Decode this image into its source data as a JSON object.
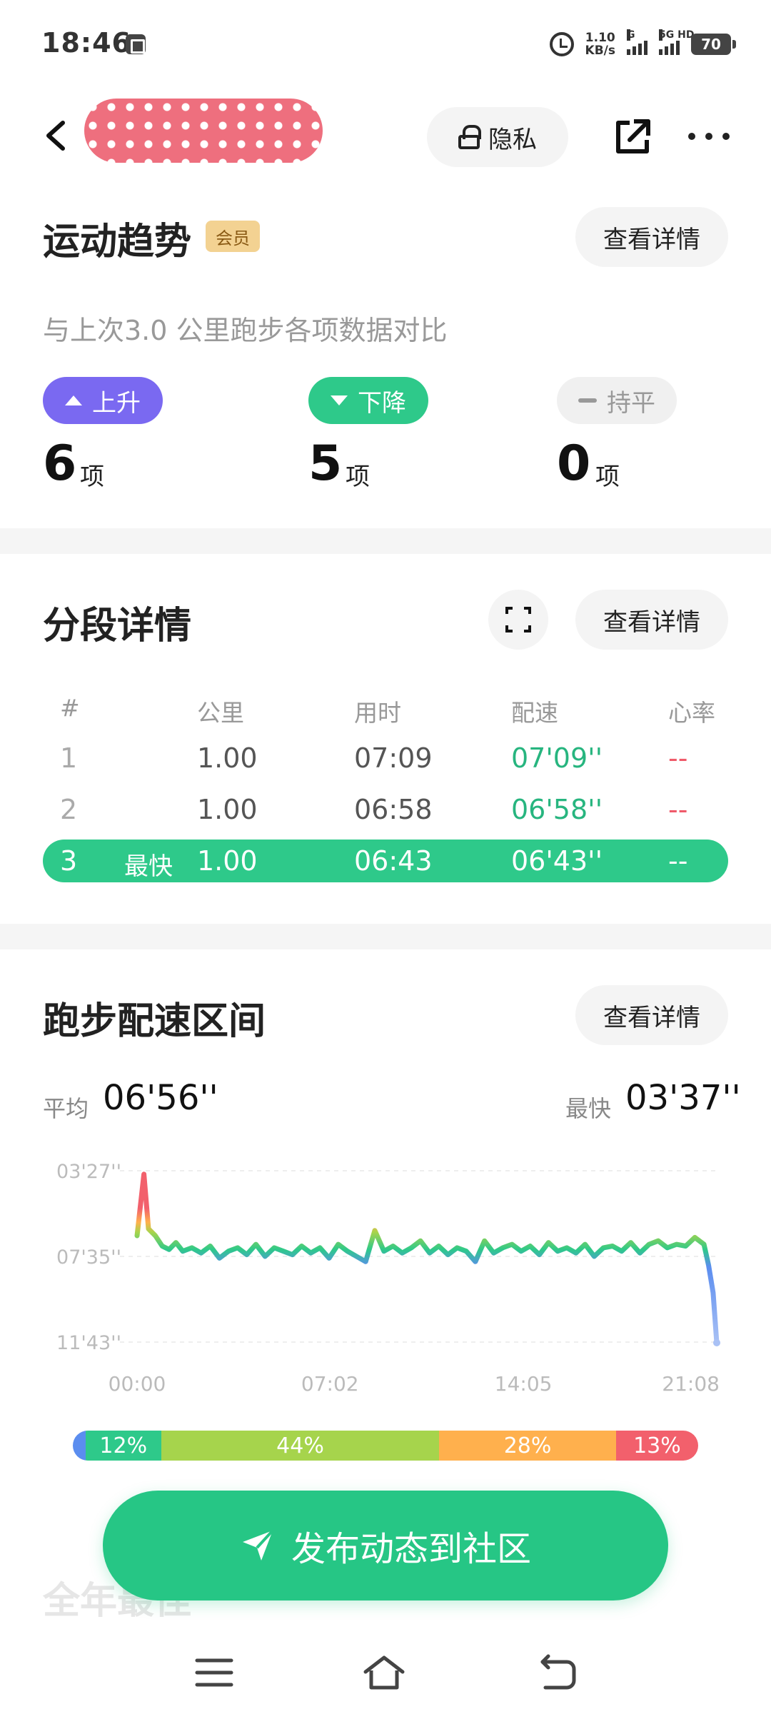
{
  "status_bar": {
    "time": "18:46",
    "net_speed_value": "1.10",
    "net_speed_unit": "KB/s",
    "signal1_label": "G",
    "signal2_label": "5G HD",
    "battery": "70"
  },
  "header": {
    "privacy_label": "隐私",
    "icons": [
      "back-icon",
      "lock-icon",
      "share-icon",
      "more-icon"
    ]
  },
  "trend": {
    "title": "运动趋势",
    "member_badge": "会员",
    "detail_label": "查看详情",
    "description": "与上次3.0 公里跑步各项数据对比",
    "up": {
      "label": "上升",
      "count": "6",
      "unit": "项"
    },
    "down": {
      "label": "下降",
      "count": "5",
      "unit": "项"
    },
    "flat": {
      "label": "持平",
      "count": "0",
      "unit": "项"
    }
  },
  "splits": {
    "title": "分段详情",
    "detail_label": "查看详情",
    "headers": [
      "#",
      "公里",
      "用时",
      "配速",
      "心率"
    ],
    "rows": [
      {
        "index": "1",
        "tag": "",
        "km": "1.00",
        "time": "07:09",
        "pace": "07'09''",
        "hr": "--"
      },
      {
        "index": "2",
        "tag": "",
        "km": "1.00",
        "time": "06:58",
        "pace": "06'58''",
        "hr": "--"
      },
      {
        "index": "3",
        "tag": "最快",
        "km": "1.00",
        "time": "06:43",
        "pace": "06'43''",
        "hr": "--"
      }
    ]
  },
  "pace_zone": {
    "title": "跑步配速区间",
    "detail_label": "查看详情",
    "avg_label": "平均",
    "avg_value": "06'56''",
    "fast_label": "最快",
    "fast_value": "03'37''",
    "zones": [
      {
        "label": "",
        "pct": 2,
        "color": "#5b8def"
      },
      {
        "label": "12%",
        "pct": 12,
        "color": "#2ec98a"
      },
      {
        "label": "44%",
        "pct": 44,
        "color": "#a6d44c"
      },
      {
        "label": "28%",
        "pct": 28,
        "color": "#ffb04d"
      },
      {
        "label": "13%",
        "pct": 13,
        "color": "#f2606c"
      }
    ]
  },
  "chart_data": {
    "type": "line",
    "title": "",
    "xlabel": "",
    "ylabel": "",
    "y_ticks": [
      "03'27''",
      "07'35''",
      "11'43''"
    ],
    "x_ticks": [
      "00:00",
      "07:02",
      "14:05",
      "21:08"
    ],
    "ylim_seconds": [
      207,
      703
    ],
    "xlim_seconds": [
      0,
      1268
    ],
    "inverted_y": true,
    "series": [
      {
        "x_seconds": [
          0,
          15,
          25,
          40,
          55,
          70,
          85,
          100,
          120,
          140,
          160,
          180,
          200,
          220,
          240,
          260,
          280,
          300,
          320,
          340,
          360,
          380,
          400,
          420,
          440,
          460,
          480,
          500,
          520,
          540,
          560,
          580,
          600,
          620,
          640,
          660,
          680,
          700,
          720,
          740,
          760,
          780,
          800,
          820,
          840,
          860,
          880,
          900,
          920,
          940,
          960,
          980,
          1000,
          1020,
          1040,
          1060,
          1080,
          1100,
          1120,
          1140,
          1160,
          1180,
          1200,
          1220,
          1240,
          1250,
          1260,
          1268
        ],
        "y_seconds": [
          395,
          217,
          375,
          395,
          425,
          435,
          415,
          440,
          430,
          445,
          425,
          460,
          440,
          430,
          450,
          420,
          455,
          430,
          440,
          450,
          425,
          445,
          430,
          460,
          420,
          440,
          455,
          470,
          380,
          440,
          425,
          445,
          430,
          410,
          445,
          425,
          450,
          430,
          440,
          470,
          410,
          445,
          430,
          420,
          440,
          425,
          450,
          415,
          440,
          430,
          445,
          420,
          455,
          430,
          425,
          440,
          415,
          445,
          420,
          410,
          430,
          420,
          425,
          400,
          420,
          480,
          560,
          705
        ]
      }
    ]
  },
  "publish": {
    "label": "发布动态到社区"
  },
  "peek": {
    "year_best": "全年最佳"
  }
}
